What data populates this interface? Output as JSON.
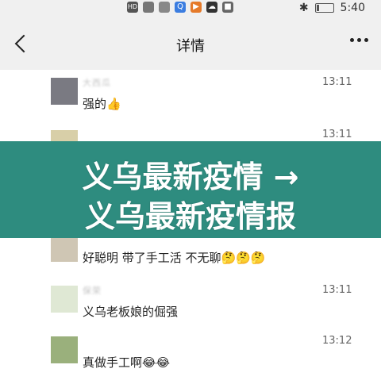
{
  "status_bar": {
    "time": "5:40",
    "icons": [
      "hd-icon",
      "signal-icon",
      "wifi-icon",
      "q-app-icon",
      "play-app-icon",
      "cloud-app-icon",
      "square-app-icon"
    ],
    "hd_label": "HD"
  },
  "header": {
    "title": "详情"
  },
  "messages": [
    {
      "sender": "大西瓜",
      "time": "13:11",
      "text": "强的👍"
    },
    {
      "sender": "",
      "time": "13:11",
      "text": ""
    },
    {
      "sender": "",
      "time": "",
      "text": "好聪明 带了手工活 不无聊🤔🤔🤔"
    },
    {
      "sender": "保荣",
      "time": "13:11",
      "text": "义乌老板娘的倔强"
    },
    {
      "sender": "",
      "time": "13:12",
      "text": "真做手工啊😂😂"
    }
  ],
  "banner": {
    "line1": "义乌最新疫情 →",
    "line2": "义乌最新疫情报"
  },
  "colors": {
    "banner_bg": "#2e8c7f",
    "header_bg": "#f0f0f0"
  }
}
